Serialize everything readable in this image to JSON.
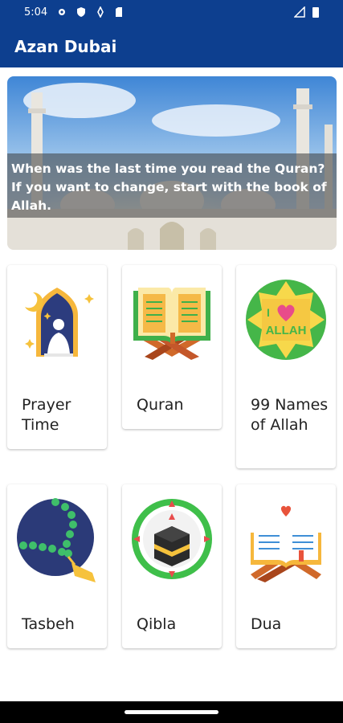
{
  "status_bar": {
    "time": "5:04"
  },
  "app_bar": {
    "title": "Azan Dubai"
  },
  "banner": {
    "quote": "When was the last time you read the Quran? If you want to change, start with the book of Allah."
  },
  "cards": [
    {
      "label": "Prayer Time",
      "icon": "prayer-icon"
    },
    {
      "label": "Quran",
      "icon": "quran-icon"
    },
    {
      "label": "99 Names of Allah",
      "icon": "allah-names-icon"
    },
    {
      "label": "Tasbeh",
      "icon": "tasbeh-icon"
    },
    {
      "label": "Qibla",
      "icon": "qibla-compass-icon"
    },
    {
      "label": "Dua",
      "icon": "dua-book-icon"
    }
  ],
  "colors": {
    "app_bar": "#0d3f8f",
    "accent_green": "#45b649",
    "navy": "#2b3a78"
  }
}
